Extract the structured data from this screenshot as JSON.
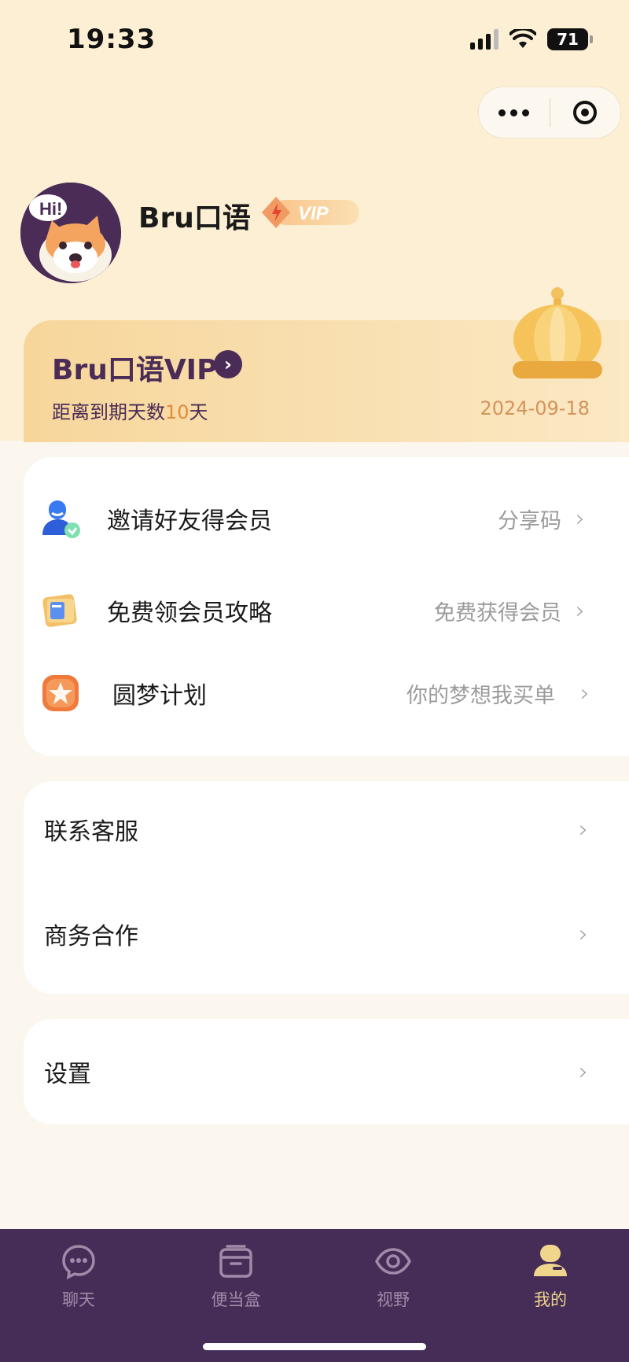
{
  "status_bar": {
    "time": "19:33",
    "battery": "71"
  },
  "profile": {
    "name": "Bru口语",
    "badge": "VIP"
  },
  "vip_card": {
    "title": "Bru口语VIP",
    "days_prefix": "距离到期天数",
    "days_number": "10",
    "days_suffix": "天",
    "expiry_date": "2024-09-18"
  },
  "menu_group_1": [
    {
      "label": "邀请好友得会员",
      "sub": "分享码",
      "icon": "invite-user-icon"
    },
    {
      "label": "免费领会员攻略",
      "sub": "免费获得会员",
      "icon": "guide-book-icon"
    },
    {
      "label": "圆梦计划",
      "sub": "你的梦想我买单",
      "icon": "star-icon"
    }
  ],
  "menu_group_2": [
    {
      "label": "联系客服"
    },
    {
      "label": "商务合作"
    }
  ],
  "menu_group_3": [
    {
      "label": "设置"
    }
  ],
  "tabbar": [
    {
      "label": "聊天",
      "icon": "chat-icon",
      "active": false
    },
    {
      "label": "便当盒",
      "icon": "box-icon",
      "active": false
    },
    {
      "label": "视野",
      "icon": "eye-icon",
      "active": false
    },
    {
      "label": "我的",
      "icon": "profile-icon",
      "active": true
    }
  ],
  "colors": {
    "primary": "#452d57",
    "accent": "#e08a3c",
    "background": "#fcefd3"
  }
}
